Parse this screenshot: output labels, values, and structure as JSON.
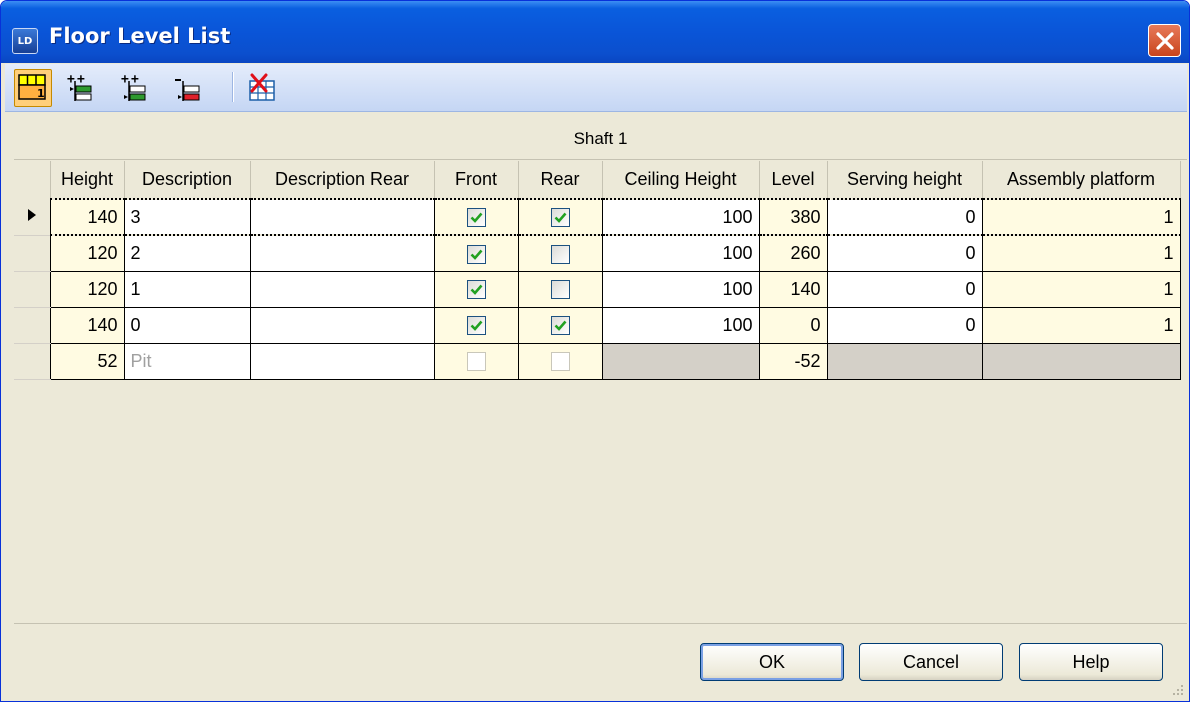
{
  "window": {
    "title": "Floor Level List",
    "app_icon_text": "LD"
  },
  "toolbar": {
    "buttons": [
      {
        "name": "show-floors-icon",
        "active": true
      },
      {
        "name": "insert-floor-above-icon"
      },
      {
        "name": "insert-floor-below-icon"
      },
      {
        "name": "delete-floor-icon"
      },
      {
        "name": "delete-table-icon"
      }
    ]
  },
  "grid": {
    "shaft_title": "Shaft 1",
    "columns": [
      "Height",
      "Description",
      "Description Rear",
      "Front",
      "Rear",
      "Ceiling Height",
      "Level",
      "Serving height",
      "Assembly platform"
    ],
    "rows": [
      {
        "height": "140",
        "description": "3",
        "description_rear": "",
        "front": true,
        "rear": true,
        "ceiling_height": "100",
        "level": "380",
        "serving_height": "0",
        "assembly_platform": "1",
        "selected": true
      },
      {
        "height": "120",
        "description": "2",
        "description_rear": "",
        "front": true,
        "rear": false,
        "ceiling_height": "100",
        "level": "260",
        "serving_height": "0",
        "assembly_platform": "1"
      },
      {
        "height": "120",
        "description": "1",
        "description_rear": "",
        "front": true,
        "rear": false,
        "ceiling_height": "100",
        "level": "140",
        "serving_height": "0",
        "assembly_platform": "1"
      },
      {
        "height": "140",
        "description": "0",
        "description_rear": "",
        "front": true,
        "rear": true,
        "ceiling_height": "100",
        "level": "0",
        "serving_height": "0",
        "assembly_platform": "1"
      },
      {
        "height": "52",
        "description": "Pit",
        "description_rear": "",
        "front": false,
        "rear": false,
        "ceiling_height": "",
        "level": "-52",
        "serving_height": "",
        "assembly_platform": "",
        "pit": true
      }
    ]
  },
  "buttons": {
    "ok": "OK",
    "cancel": "Cancel",
    "help": "Help"
  },
  "colors": {
    "title_bar": "#0a55d8",
    "dialog_bg": "#ece9d8",
    "readonly_cell": "#fffbe2",
    "disabled_cell": "#d4d0c8",
    "check_green": "#21a121"
  }
}
